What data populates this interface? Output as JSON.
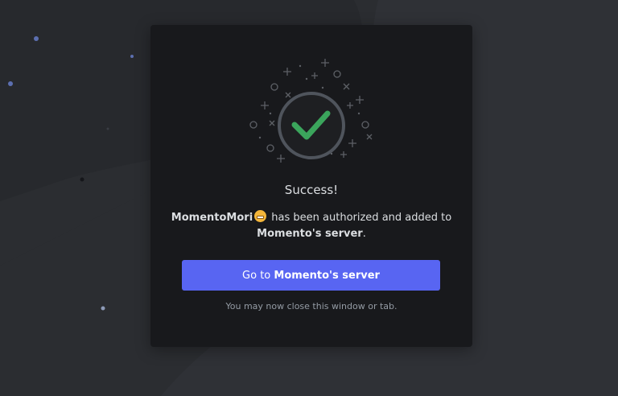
{
  "dialog": {
    "title": "Success!",
    "bot_name": "MomentoMori",
    "bot_emoji": "grinning-face-icon",
    "message_mid": " has been authorized and added to",
    "server_name": "Momento's server",
    "message_end": ".",
    "button_prefix": "Go to ",
    "button_server": "Momento's server",
    "note": "You may now close this window or tab."
  },
  "colors": {
    "background": "#2b2d31",
    "modal": "#18191c",
    "button": "#5865f2",
    "check": "#3ba55c"
  }
}
